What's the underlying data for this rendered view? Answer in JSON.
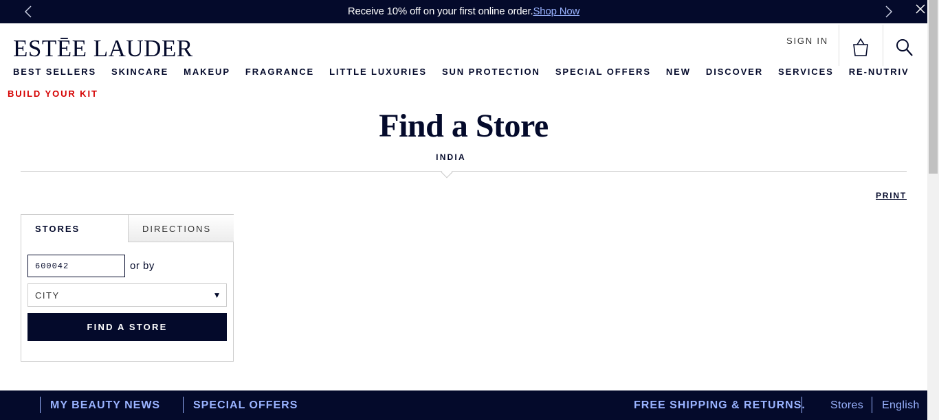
{
  "promo": {
    "message": "Receive 10% off on your first online order.",
    "link": "Shop Now"
  },
  "header": {
    "logo": "ESTĒE LAUDER",
    "sign_in": "SIGN IN"
  },
  "nav": {
    "items": [
      "BEST SELLERS",
      "SKINCARE",
      "MAKEUP",
      "FRAGRANCE",
      "LITTLE LUXURIES",
      "SUN PROTECTION",
      "SPECIAL OFFERS",
      "NEW",
      "DISCOVER",
      "SERVICES",
      "RE-NUTRIV"
    ],
    "build_your_kit": "BUILD YOUR KIT"
  },
  "page": {
    "title": "Find a Store",
    "country": "INDIA",
    "print": "PRINT"
  },
  "locator": {
    "tabs": [
      "STORES",
      "DIRECTIONS"
    ],
    "zip_value": "600042",
    "or_by": "or by",
    "city_label": "CITY",
    "find_button": "FIND A STORE"
  },
  "footer": {
    "beauty_news": "MY BEAUTY NEWS",
    "special_offers": "SPECIAL OFFERS",
    "free_shipping": "FREE SHIPPING & RETURNS.",
    "stores": "Stores",
    "language": "English"
  },
  "colors": {
    "navy": "#040a2b",
    "accent_blue": "#9ab3ff",
    "kit_red": "#d50000"
  }
}
